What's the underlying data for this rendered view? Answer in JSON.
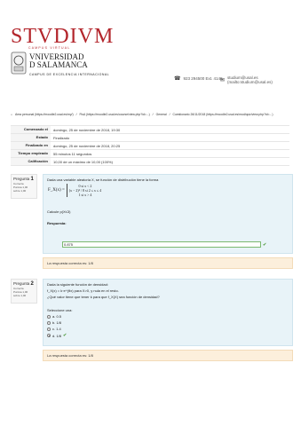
{
  "brand": {
    "logo_text": "STVDIVM",
    "logo_sub": "CAMPUS VIRTUAL",
    "univ_line1": "VNIVERSIDAD",
    "univ_line2": "D SALAMANCA",
    "univ_sub": "CAMPUS DE EXCELENCIA INTERNACIONAL"
  },
  "contact": {
    "phone": "923 294500 Ext. 4148",
    "email": "studium@usal.es (mailto:studium@usal.es)"
  },
  "breadcrumb": [
    "Área personal (https://moodle2.usal.es/my/)",
    "/",
    "FisA (https://moodle2.usal.es/course/view.php?id=...)",
    "/",
    "General",
    "/",
    "Cuestionario 26/11/2018 (https://moodle2.usal.es/mod/quiz/view.php?id=...)"
  ],
  "summary": [
    {
      "label": "Comenzado el",
      "value": "domingo, 25 de noviembre de 2018, 19:30"
    },
    {
      "label": "Estado",
      "value": "Finalizado"
    },
    {
      "label": "Finalizado en",
      "value": "domingo, 25 de noviembre de 2018, 20:25"
    },
    {
      "label": "Tiempo empleado",
      "value": "55 minutos 11 segundos"
    },
    {
      "label": "Calificación",
      "value": "10,00 de un máximo de 10,00 (100%)"
    }
  ],
  "q1": {
    "prefix": "Pregunta",
    "number": "1",
    "status": "Correcta",
    "points": "Puntúa 1,00 sobre 1,00",
    "text": "Dada una variable aleatoria X, se función de distribución tiene la forma",
    "fx_label": "F_X(x) =",
    "case1": "0 si x < 2",
    "case2": "(x − 2)² / 8 si 2 ≤ x ≤ 4",
    "case3": "1 si x > 4",
    "ask": "Calcule p(X≤3)",
    "answer_label": "Respuesta:",
    "answer_value": "0.875",
    "feedback": "La respuesta correcta es: 1/8"
  },
  "q2": {
    "prefix": "Pregunta",
    "number": "2",
    "status": "Correcta",
    "points": "Puntúa 1,00 sobre 1,00",
    "text": "Dada la siguiente función de densidad:",
    "line2": "f_X(x) = k·e^(θx) para X>0, y nula en el resto.",
    "line3": "¿Qué valor tiene que tener k para que f_X(X) sea función de densidad?",
    "select_label": "Seleccione una:",
    "options": [
      "a. 0.5",
      "b. 1/8",
      "c. 1.4",
      "d. 1/8"
    ],
    "feedback": "La respuesta correcta es: 1/8"
  }
}
